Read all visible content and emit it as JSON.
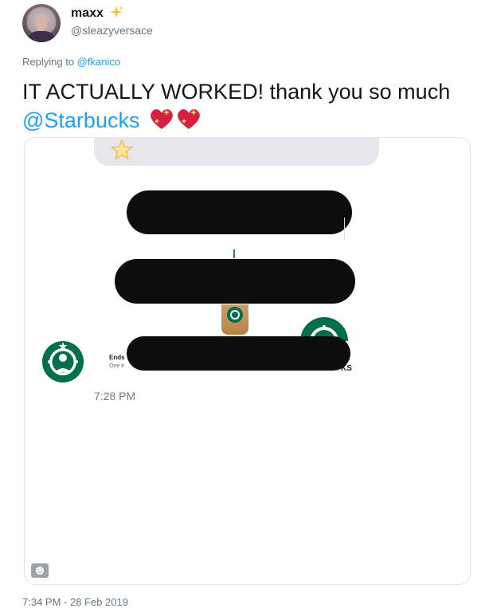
{
  "user": {
    "display_name": "maxx",
    "handle": "@sleazyversace"
  },
  "reply": {
    "prefix": "Replying to",
    "to": "@fkanico"
  },
  "tweet": {
    "text": "IT ACTUALLY WORKED! thank you so much",
    "mention": "@Starbucks"
  },
  "media": {
    "message_time": "7:28 PM",
    "ends_label": "Ends",
    "one_time_label": "One ti",
    "brand_fragment": "KS"
  },
  "footer": {
    "timestamp": "7:34 PM - 28 Feb 2019"
  },
  "colors": {
    "link": "#1da1f2",
    "muted": "#657786",
    "starbucks_green": "#00704a"
  },
  "icons": [
    "sparkles-icon",
    "sparkling-heart-icon",
    "star-icon",
    "starbucks-logo-icon",
    "gif-badge-icon"
  ]
}
